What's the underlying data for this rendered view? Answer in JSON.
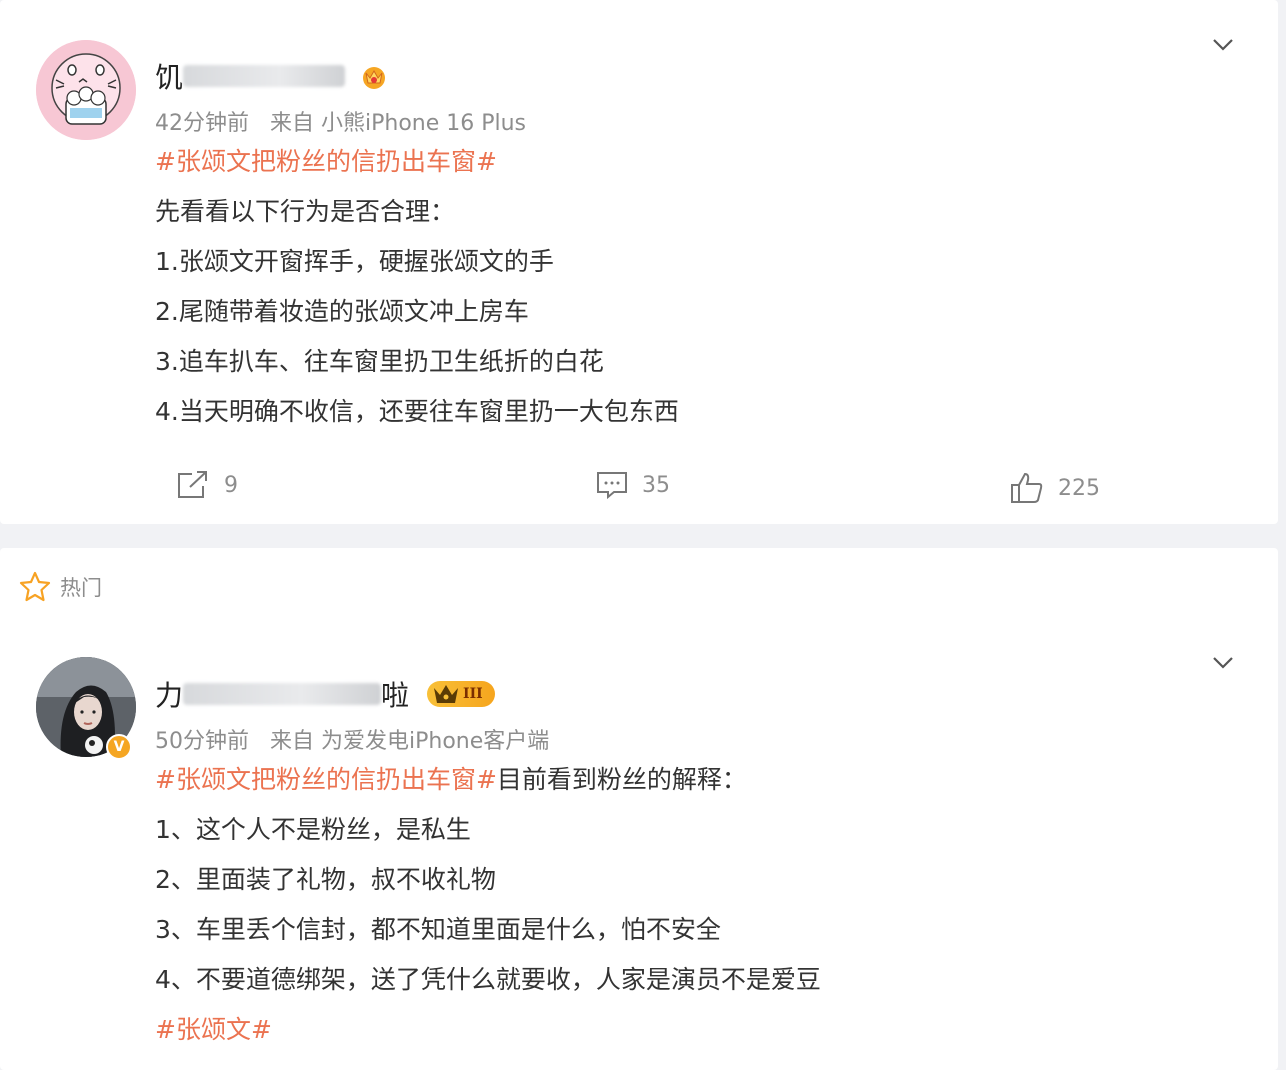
{
  "posts": [
    {
      "username_visible_prefix": "饥",
      "timestamp": "42分钟前",
      "source": "来自 小熊iPhone 16 Plus",
      "hashtag": "#张颂文把粉丝的信扔出车窗#",
      "lines": [
        "先看看以下行为是否合理：",
        "1.张颂文开窗挥手，硬握张颂文的手",
        "2.尾随带着妆造的张颂文冲上房车",
        "3.追车扒车、往车窗里扔卫生纸折的白花",
        "4.当天明确不收信，还要往车窗里扔一大包东西"
      ],
      "repost_count": "9",
      "comment_count": "35",
      "like_count": "225"
    },
    {
      "username_visible_prefix": "力",
      "username_visible_suffix": "啦",
      "timestamp": "50分钟前",
      "source": "来自 为爱发电iPhone客户端",
      "hashtag": "#张颂文把粉丝的信扔出车窗#",
      "hashtag_trailing": "目前看到粉丝的解释：",
      "lines": [
        "1、这个人不是粉丝，是私生",
        "2、里面装了礼物，叔不收礼物",
        "3、车里丢个信封，都不知道里面是什么，怕不安全",
        "4、不要道德绑架，送了凭什么就要收，人家是演员不是爱豆"
      ],
      "footer_hashtag": "#张颂文#",
      "level_badge": "III",
      "verified_badge": "V"
    }
  ],
  "section": {
    "hot_label": "热门"
  },
  "colors": {
    "topic": "#eb7350",
    "meta": "#8d8d8d",
    "badge": "#f5a623"
  }
}
